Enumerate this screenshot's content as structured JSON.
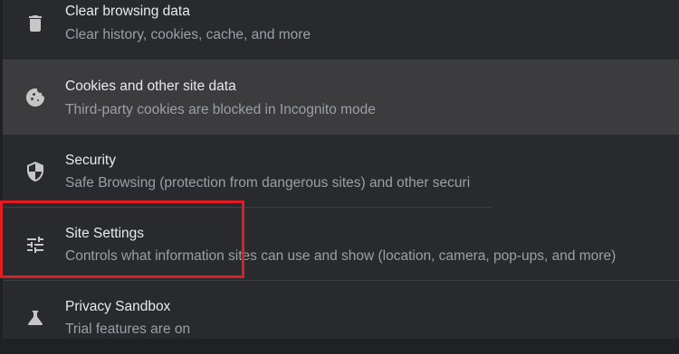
{
  "privacy_section": {
    "items": [
      {
        "title": "Clear browsing data",
        "subtitle": "Clear history, cookies, cache, and more",
        "icon": "trash-icon"
      },
      {
        "title": "Cookies and other site data",
        "subtitle": "Third-party cookies are blocked in Incognito mode",
        "icon": "cookie-icon",
        "hovered": true
      },
      {
        "title": "Security",
        "subtitle": "Safe Browsing (protection from dangerous sites) and other securi",
        "icon": "shield-icon"
      },
      {
        "title": "Site Settings",
        "subtitle": "Controls what information sites can use and show (location, camera, pop-ups, and more)",
        "icon": "tune-sliders-icon",
        "annotated": true
      },
      {
        "title": "Privacy Sandbox",
        "subtitle": "Trial features are on",
        "icon": "flask-icon"
      }
    ]
  },
  "colors": {
    "background": "#292a2d",
    "hover_background": "#3c3c3f",
    "title_text": "#e8eaed",
    "subtitle_text": "#9aa0a6",
    "annotation_border": "#e31b23"
  }
}
